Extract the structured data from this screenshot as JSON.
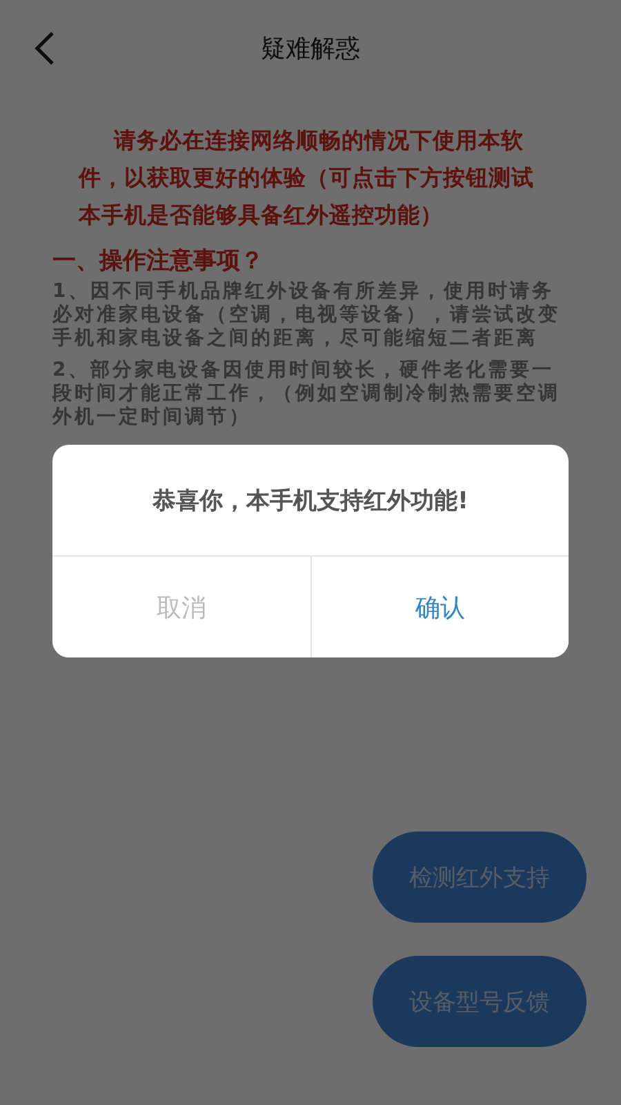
{
  "header": {
    "title": "疑难解惑"
  },
  "notice": "请务必在连接网络顺畅的情况下使用本软件，以获取更好的体验（可点击下方按钮测试本手机是否能够具备红外遥控功能）",
  "section": {
    "heading": "一、操作注意事项？",
    "items": [
      "1、因不同手机品牌红外设备有所差异，使用时请务必对准家电设备（空调，电视等设备），请尝试改变手机和家电设备之间的距离，尽可能缩短二者距离",
      "2、部分家电设备因使用时间较长，硬件老化需要一段时间才能正常工作，（例如空调制冷制热需要空调外机一定时间调节）"
    ]
  },
  "actions": [
    "检测红外支持",
    "设备型号反馈"
  ],
  "dialog": {
    "message": "恭喜你，本手机支持红外功能!",
    "buttons": [
      {
        "label": "取消",
        "kind": "cancel"
      },
      {
        "label": "确认",
        "kind": "confirm"
      }
    ]
  }
}
